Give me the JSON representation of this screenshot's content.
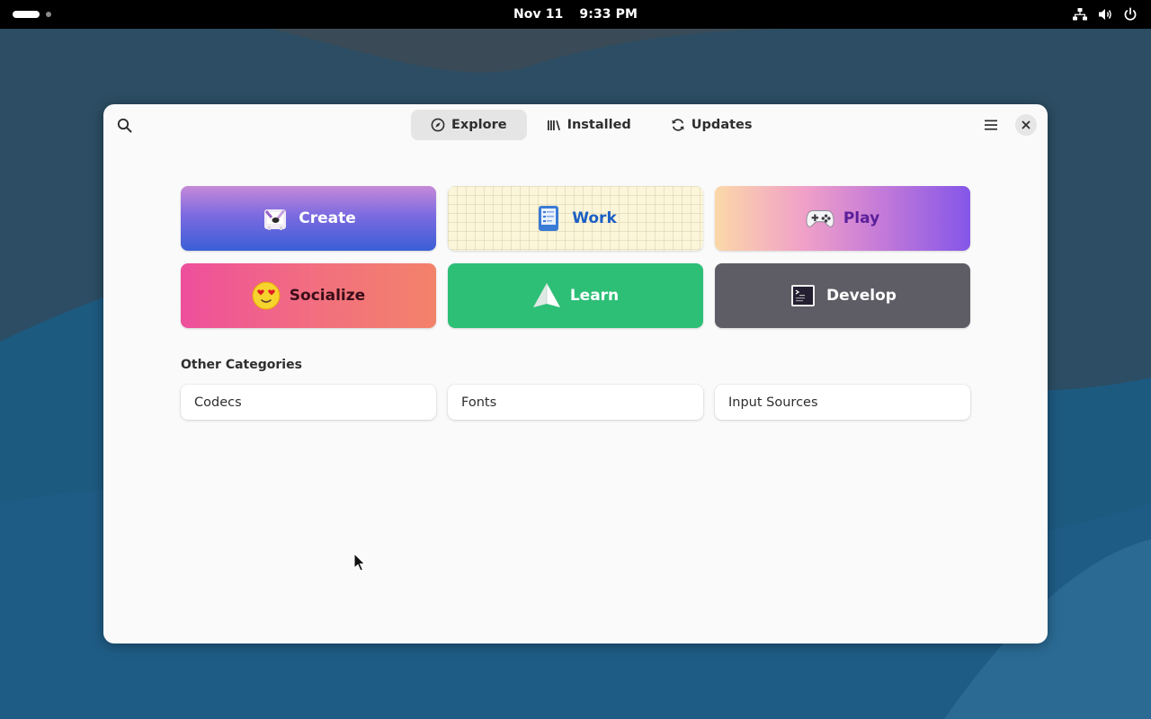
{
  "topbar": {
    "date": "Nov 11",
    "time": "9:33 PM",
    "tray_icons": [
      "network-wired-icon",
      "volume-icon",
      "power-icon"
    ]
  },
  "window": {
    "tabs": [
      {
        "label": "Explore",
        "icon": "compass-icon",
        "active": true
      },
      {
        "label": "Installed",
        "icon": "library-icon",
        "active": false
      },
      {
        "label": "Updates",
        "icon": "refresh-icon",
        "active": false
      }
    ],
    "categories": [
      {
        "label": "Create",
        "icon": "create-icon"
      },
      {
        "label": "Work",
        "icon": "work-icon"
      },
      {
        "label": "Play",
        "icon": "gamepad-icon"
      },
      {
        "label": "Socialize",
        "icon": "heart-eyes-icon"
      },
      {
        "label": "Learn",
        "icon": "paper-plane-icon"
      },
      {
        "label": "Develop",
        "icon": "terminal-icon"
      }
    ],
    "other_categories": {
      "heading": "Other Categories",
      "items": [
        "Codecs",
        "Fonts",
        "Input Sources"
      ]
    }
  },
  "colors": {
    "wallpaper": "#215478",
    "learn": "#2ebf77",
    "develop": "#5e5c64",
    "work_text": "#1c5fc4"
  }
}
